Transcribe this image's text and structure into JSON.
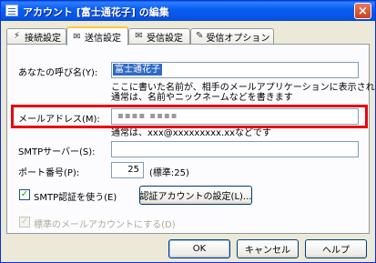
{
  "window": {
    "title": "アカウント [富士通花子] の編集",
    "close_glyph": "×"
  },
  "tabs": [
    {
      "label": "接続設定",
      "icon": "connection-icon",
      "glyph": "⚡"
    },
    {
      "label": "送信設定",
      "icon": "send-icon",
      "glyph": "✉"
    },
    {
      "label": "受信設定",
      "icon": "receive-icon",
      "glyph": "✉"
    },
    {
      "label": "受信オプション",
      "icon": "wrench-icon",
      "glyph": "✎"
    }
  ],
  "form": {
    "name_label": "あなたの呼び名(Y):",
    "name_value": "富士通花子",
    "name_note_1": "ここに書いた名前が、相手のメールアプリケーションに表示されます",
    "name_note_2": "通常は、名前やニックネームなどを書きます",
    "email_label": "メールアドレス(M):",
    "email_value": "▪▪▪▪ ▪▪▪▪",
    "email_note": "通常は、xxx@xxxxxxxxx.xxなどです",
    "smtp_label": "SMTPサーバー(S):",
    "smtp_value": "",
    "port_label": "ポート番号(P):",
    "port_value": "25",
    "port_note": "(標準:25)",
    "smtp_auth_label": "SMTP認証を使う(E)",
    "smtp_auth_checked": true,
    "auth_button_label": "認証アカウントの設定(L)...",
    "default_account_label": "標準のメールアカウントにする(D)",
    "default_account_checked": true,
    "check_glyph": "✓"
  },
  "buttons": {
    "ok": "OK",
    "cancel": "キャンセル",
    "help": "ヘルプ"
  },
  "colors": {
    "highlight": "#e8000f",
    "title_bar": "#0554e3",
    "selection": "#316ac5"
  }
}
